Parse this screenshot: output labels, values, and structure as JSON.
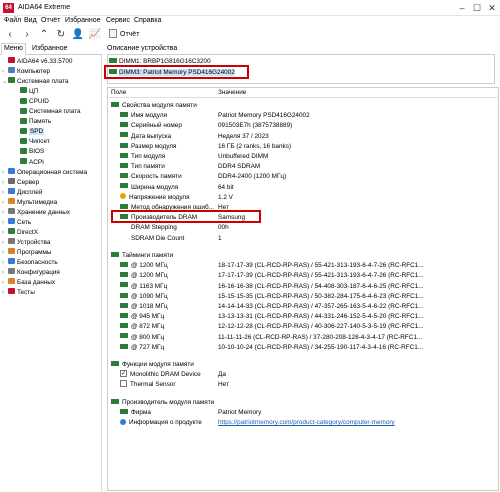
{
  "window": {
    "title": "AIDA64 Extreme",
    "logo": "64"
  },
  "menu": [
    "Файл",
    "Вид",
    "Отчёт",
    "Избранное",
    "Сервис",
    "Справка"
  ],
  "toolbar": {
    "report_label": "Отчёт"
  },
  "left_tabs": [
    "Меню",
    "Избранное"
  ],
  "tree": [
    {
      "label": "AIDA64 v6.33.5700",
      "icon": "aida-logo-icon",
      "level": 0,
      "arrow": ""
    },
    {
      "label": "Компьютер",
      "icon": "computer-icon",
      "level": 1,
      "arrow": "›"
    },
    {
      "label": "Системная плата",
      "icon": "motherboard-icon",
      "level": 1,
      "arrow": "⌄"
    },
    {
      "label": "ЦП",
      "icon": "cpu-icon",
      "level": 2,
      "arrow": ""
    },
    {
      "label": "CPUID",
      "icon": "cpuid-icon",
      "level": 2,
      "arrow": ""
    },
    {
      "label": "Системная плата",
      "icon": "board-icon",
      "level": 2,
      "arrow": ""
    },
    {
      "label": "Память",
      "icon": "memory-icon",
      "level": 2,
      "arrow": ""
    },
    {
      "label": "SPD",
      "icon": "spd-icon",
      "level": 2,
      "arrow": "",
      "selected": true
    },
    {
      "label": "Чипсет",
      "icon": "chipset-icon",
      "level": 2,
      "arrow": ""
    },
    {
      "label": "BIOS",
      "icon": "bios-icon",
      "level": 2,
      "arrow": ""
    },
    {
      "label": "ACPI",
      "icon": "acpi-icon",
      "level": 2,
      "arrow": ""
    },
    {
      "label": "Операционная система",
      "icon": "os-icon",
      "level": 1,
      "arrow": "›"
    },
    {
      "label": "Сервер",
      "icon": "server-icon",
      "level": 1,
      "arrow": "›"
    },
    {
      "label": "Дисплей",
      "icon": "display-icon",
      "level": 1,
      "arrow": "›"
    },
    {
      "label": "Мультимедиа",
      "icon": "multimedia-icon",
      "level": 1,
      "arrow": "›"
    },
    {
      "label": "Хранение данных",
      "icon": "storage-icon",
      "level": 1,
      "arrow": "›"
    },
    {
      "label": "Сеть",
      "icon": "network-icon",
      "level": 1,
      "arrow": "›"
    },
    {
      "label": "DirectX",
      "icon": "directx-icon",
      "level": 1,
      "arrow": "›"
    },
    {
      "label": "Устройства",
      "icon": "devices-icon",
      "level": 1,
      "arrow": "›"
    },
    {
      "label": "Программы",
      "icon": "programs-icon",
      "level": 1,
      "arrow": "›"
    },
    {
      "label": "Безопасность",
      "icon": "security-icon",
      "level": 1,
      "arrow": "›"
    },
    {
      "label": "Конфигурация",
      "icon": "config-icon",
      "level": 1,
      "arrow": "›"
    },
    {
      "label": "База данных",
      "icon": "database-icon",
      "level": 1,
      "arrow": "›"
    },
    {
      "label": "Тесты",
      "icon": "tests-icon",
      "level": 1,
      "arrow": "›"
    }
  ],
  "device_panel": {
    "title": "Описание устройства",
    "devices": [
      {
        "label": "DIMM1: BRBP1G816G16C3200",
        "selected": false
      },
      {
        "label": "DIMM3: Patriot Memory PSD416G24002",
        "selected": true
      }
    ]
  },
  "grid": {
    "col_field": "Поле",
    "col_value": "Значение",
    "rows": [
      {
        "type": "group",
        "field": "Свойства модуля памяти",
        "icon": "memory-module-icon"
      },
      {
        "type": "item",
        "field": "Имя модуля",
        "value": "Patriot Memory PSD416G24002",
        "icon": "memory-module-icon"
      },
      {
        "type": "item",
        "field": "Серийный номер",
        "value": "091503E7h (3875738889)",
        "icon": "memory-module-icon"
      },
      {
        "type": "item",
        "field": "Дата выпуска",
        "value": "Неделя 37 / 2023",
        "icon": "memory-module-icon"
      },
      {
        "type": "item",
        "field": "Размер модуля",
        "value": "16 ГБ (2 ranks, 16 banks)",
        "icon": "memory-module-icon"
      },
      {
        "type": "item",
        "field": "Тип модуля",
        "value": "Unbuffered DIMM",
        "icon": "memory-module-icon"
      },
      {
        "type": "item",
        "field": "Тип памяти",
        "value": "DDR4 SDRAM",
        "icon": "memory-module-icon"
      },
      {
        "type": "item",
        "field": "Скорость памяти",
        "value": "DDR4-2400 (1200 МГц)",
        "icon": "memory-module-icon"
      },
      {
        "type": "item",
        "field": "Ширина модуля",
        "value": "64 bit",
        "icon": "memory-module-icon"
      },
      {
        "type": "item",
        "field": "Напряжение модуля",
        "value": "1.2 V",
        "icon": "voltage-icon"
      },
      {
        "type": "item",
        "field": "Метод обнаружения ошиб...",
        "value": "Нет",
        "icon": "memory-module-icon"
      },
      {
        "type": "item",
        "field": "Производитель DRAM",
        "value": "Samsung",
        "icon": "memory-module-icon"
      },
      {
        "type": "item",
        "field": "DRAM Stepping",
        "value": "00h",
        "icon": "blank-icon"
      },
      {
        "type": "item",
        "field": "SDRAM Die Count",
        "value": "1",
        "icon": "blank-icon"
      },
      {
        "type": "spacer"
      },
      {
        "type": "group",
        "field": "Тайминги памяти",
        "icon": "memory-module-icon"
      },
      {
        "type": "item",
        "field": "@ 1200 МГц",
        "value": "18-17-17-39  (CL-RCD-RP-RAS) / 55-421-313-193-6-4-7-26  (RC-RFC1...",
        "icon": "memory-module-icon"
      },
      {
        "type": "item",
        "field": "@ 1200 МГц",
        "value": "17-17-17-39  (CL-RCD-RP-RAS) / 55-421-313-193-6-4-7-26  (RC-RFC1...",
        "icon": "memory-module-icon"
      },
      {
        "type": "item",
        "field": "@ 1163 МГц",
        "value": "16-16-16-38  (CL-RCD-RP-RAS) / 54-408-303-187-6-4-6-25  (RC-RFC1...",
        "icon": "memory-module-icon"
      },
      {
        "type": "item",
        "field": "@ 1090 МГц",
        "value": "15-15-15-35  (CL-RCD-RP-RAS) / 50-382-284-175-6-4-6-23  (RC-RFC1...",
        "icon": "memory-module-icon"
      },
      {
        "type": "item",
        "field": "@ 1018 МГц",
        "value": "14-14-14-33  (CL-RCD-RP-RAS) / 47-357-265-163-5-4-6-22  (RC-RFC1...",
        "icon": "memory-module-icon"
      },
      {
        "type": "item",
        "field": "@ 945 МГц",
        "value": "13-13-13-31  (CL-RCD-RP-RAS) / 44-331-246-152-5-4-5-20  (RC-RFC1...",
        "icon": "memory-module-icon"
      },
      {
        "type": "item",
        "field": "@ 872 МГц",
        "value": "12-12-12-28  (CL-RCD-RP-RAS) / 40-306-227-140-5-3-5-19  (RC-RFC1...",
        "icon": "memory-module-icon"
      },
      {
        "type": "item",
        "field": "@ 800 МГц",
        "value": "11-11-11-26  (CL-RCD-RP-RAS) / 37-280-208-128-4-3-4-17  (RC-RFC1...",
        "icon": "memory-module-icon"
      },
      {
        "type": "item",
        "field": "@ 727 МГц",
        "value": "10-10-10-24  (CL-RCD-RP-RAS) / 34-255-190-117-4-3-4-16  (RC-RFC1...",
        "icon": "memory-module-icon"
      },
      {
        "type": "spacer"
      },
      {
        "type": "group",
        "field": "Функции модуля памяти",
        "icon": "memory-module-icon"
      },
      {
        "type": "check",
        "field": "Monolithic DRAM Device",
        "value": "Да",
        "checked": true
      },
      {
        "type": "check",
        "field": "Thermal Sensor",
        "value": "Нет",
        "checked": false
      },
      {
        "type": "spacer"
      },
      {
        "type": "group",
        "field": "Производитель модуля памяти",
        "icon": "memory-module-icon"
      },
      {
        "type": "item",
        "field": "Фирма",
        "value": "Patriot Memory",
        "icon": "memory-module-icon"
      },
      {
        "type": "link",
        "field": "Информация о продукте",
        "value": "https://patriotmemory.com/product-category/computer-memory",
        "icon": "info-icon"
      }
    ]
  },
  "colors": {
    "memory_icon": "#2d7d3a",
    "highlight": "#cc0000",
    "selection": "#cce4f7",
    "link": "#1a5fb4",
    "logo": "#c8102e"
  }
}
